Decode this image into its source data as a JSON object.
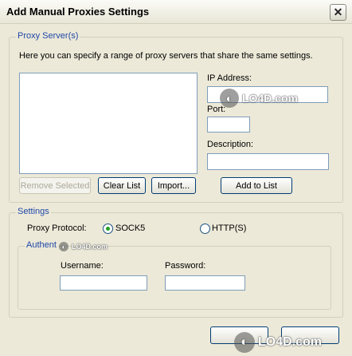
{
  "window": {
    "title": "Add Manual Proxies Settings",
    "close_glyph": "✕"
  },
  "proxy_servers": {
    "legend": "Proxy Server(s)",
    "description": "Here you can specify a range of proxy servers that share the same settings.",
    "ip_label": "IP Address:",
    "ip_value": "",
    "port_label": "Port:",
    "port_value": "",
    "desc_label": "Description:",
    "desc_value": "",
    "remove_selected": "Remove Selected",
    "clear_list": "Clear List",
    "import": "Import...",
    "add_to_list": "Add to List"
  },
  "settings": {
    "legend": "Settings",
    "protocol_label": "Proxy Protocol:",
    "socks5_label": "SOCK5",
    "https_label": "HTTP(S)",
    "selected_protocol": "SOCK5",
    "auth_legend": "Authent",
    "username_label": "Username:",
    "username_value": "",
    "password_label": "Password:",
    "password_value": ""
  },
  "watermark": {
    "text": "LO4D.com"
  },
  "colors": {
    "dialog_bg": "#ece9d8",
    "group_title": "#1f47a8",
    "field_border": "#7f9db9",
    "radio_selected": "#21a121"
  }
}
